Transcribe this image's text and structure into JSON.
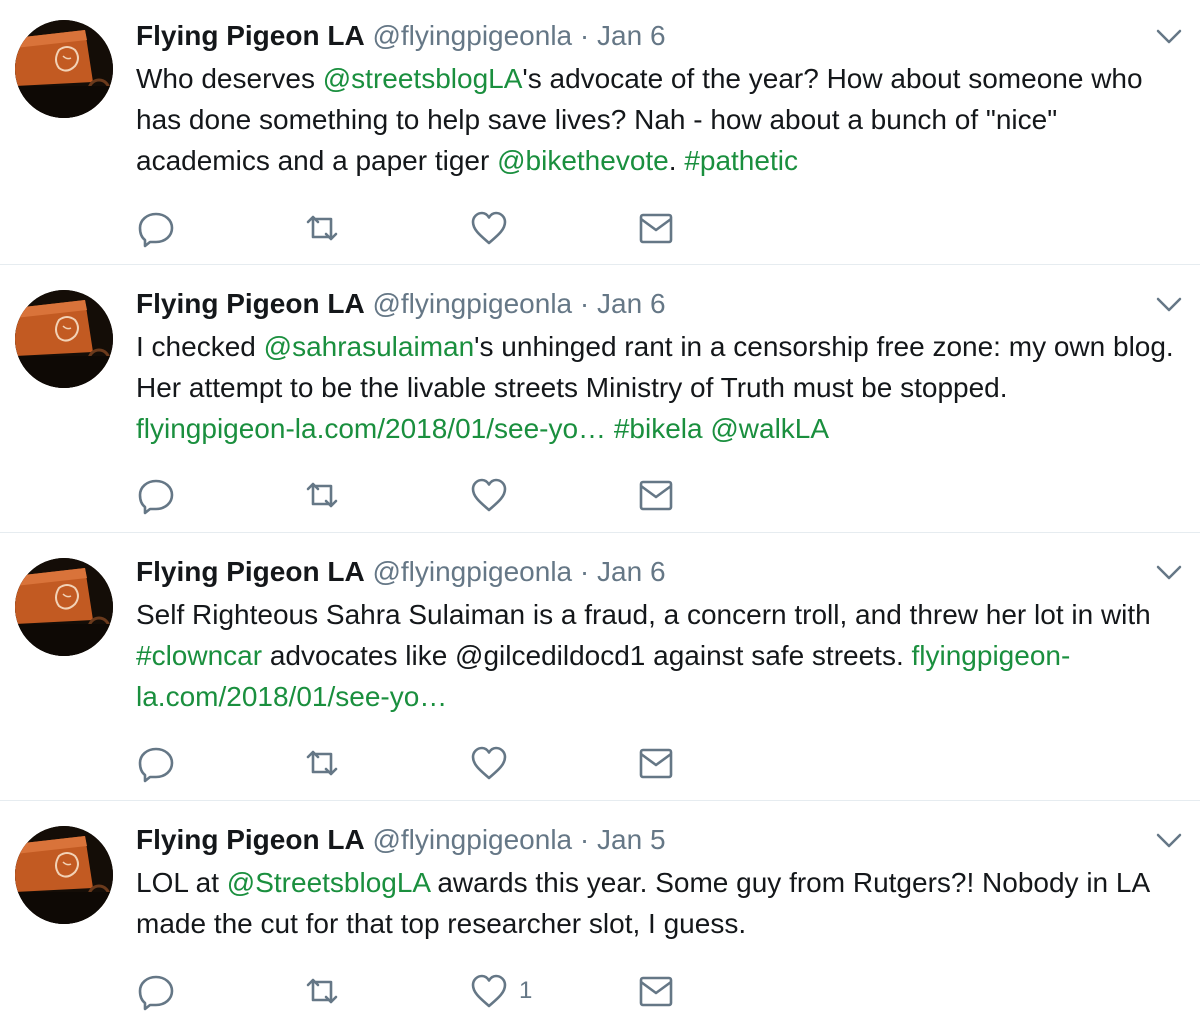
{
  "tweets": [
    {
      "name": "Flying Pigeon LA",
      "handle": "@flyingpigeonla",
      "dot": "·",
      "date": "Jan 6",
      "text": [
        {
          "t": "Who deserves ",
          "link": false
        },
        {
          "t": "@streetsblogLA",
          "link": true
        },
        {
          "t": "'s advocate of the year? How about someone who has done something to help save lives? Nah - how about a bunch of \"nice\" academics and a paper tiger ",
          "link": false
        },
        {
          "t": "@bikethevote",
          "link": true
        },
        {
          "t": ". ",
          "link": false
        },
        {
          "t": "#pathetic",
          "link": true
        }
      ],
      "like_count": ""
    },
    {
      "name": "Flying Pigeon LA",
      "handle": "@flyingpigeonla",
      "dot": "·",
      "date": "Jan 6",
      "text": [
        {
          "t": "I checked ",
          "link": false
        },
        {
          "t": "@sahrasulaiman",
          "link": true
        },
        {
          "t": "'s unhinged rant in a censorship free zone: my own blog. Her attempt to be the livable streets Ministry of Truth must be stopped. ",
          "link": false
        },
        {
          "t": "flyingpigeon-la.com/2018/01/see-yo…",
          "link": true
        },
        {
          "t": " ",
          "link": false
        },
        {
          "t": "#bikela",
          "link": true
        },
        {
          "t": " ",
          "link": false
        },
        {
          "t": "@walkLA",
          "link": true
        }
      ],
      "like_count": ""
    },
    {
      "name": "Flying Pigeon LA",
      "handle": "@flyingpigeonla",
      "dot": "·",
      "date": "Jan 6",
      "text": [
        {
          "t": "Self Righteous Sahra Sulaiman is a fraud, a concern troll, and threw her lot in with ",
          "link": false
        },
        {
          "t": "#clowncar",
          "link": true
        },
        {
          "t": " advocates like @gilcedildocd1 against safe streets. ",
          "link": false
        },
        {
          "t": "flyingpigeon-la.com/2018/01/see-yo…",
          "link": true
        }
      ],
      "like_count": ""
    },
    {
      "name": "Flying Pigeon LA",
      "handle": "@flyingpigeonla",
      "dot": "·",
      "date": "Jan 5",
      "text": [
        {
          "t": "LOL at ",
          "link": false
        },
        {
          "t": "@StreetsblogLA",
          "link": true
        },
        {
          "t": " awards this year. Some guy from Rutgers?! Nobody in LA made the cut for that top researcher slot, I guess.",
          "link": false
        }
      ],
      "like_count": "1"
    }
  ],
  "icons": {
    "reply": "reply-icon",
    "retweet": "retweet-icon",
    "like": "heart-icon",
    "message": "envelope-icon",
    "caret": "chevron-down-icon",
    "avatar": "flying-pigeon-avatar"
  },
  "colors": {
    "link": "#1a8f3e",
    "text": "#14171a",
    "muted": "#657786",
    "divider": "#e6ecf0"
  }
}
